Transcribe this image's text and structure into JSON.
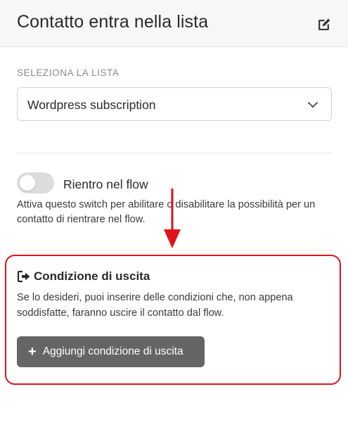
{
  "header": {
    "title": "Contatto entra nella lista",
    "edit_icon": "edit-icon"
  },
  "list_section": {
    "label": "SELEZIONA LA LISTA",
    "selected_value": "Wordpress subscription"
  },
  "reentry": {
    "label": "Rientro nel flow",
    "enabled": false,
    "description": "Attiva questo switch per abilitare o disabilitare la possibilità per un contatto di rientrare nel flow."
  },
  "exit_condition": {
    "title": "Condizione di uscita",
    "description": "Se lo desideri, puoi inserire delle condizioni che, non appena soddisfatte, faranno uscire il contatto dal flow.",
    "add_button_label": "Aggiungi condizione di uscita"
  },
  "colors": {
    "highlight": "#e0121b",
    "button_bg": "#656565",
    "header_bg": "#f7f7f7"
  }
}
